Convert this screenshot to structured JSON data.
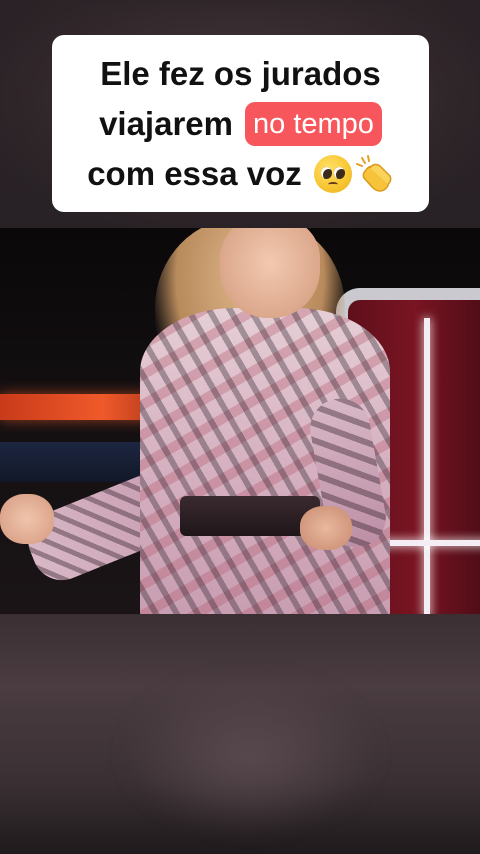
{
  "caption": {
    "line1": "Ele fez os jurados",
    "line2_prefix": "viajarem",
    "line2_highlight": "no tempo",
    "line3": "com essa voz",
    "emojis": [
      "pleading-face",
      "clapping-hands"
    ],
    "highlight_color": "#f7575c"
  },
  "video": {
    "scene": "performance-reaction"
  }
}
